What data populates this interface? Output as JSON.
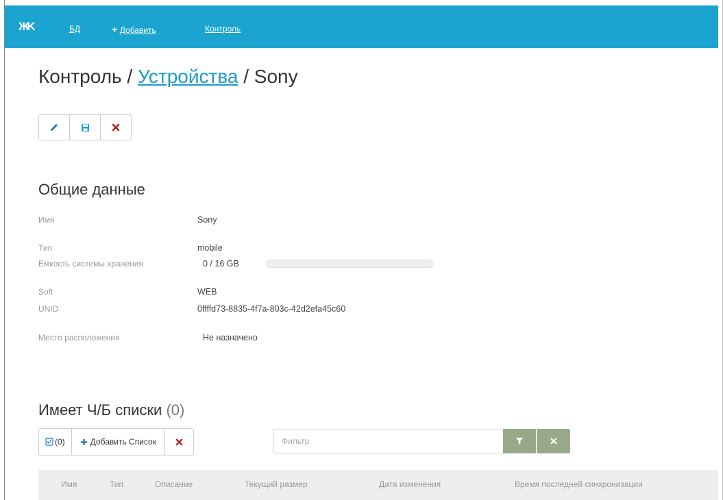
{
  "navbar": {
    "logo_text": "ЖK",
    "links": [
      {
        "label": "БД"
      },
      {
        "label": "Добавить",
        "icon": "plus-icon"
      },
      {
        "label": "Контроль"
      }
    ]
  },
  "breadcrumb": {
    "root": "Контроль",
    "sep1": "/",
    "link": "Устройства",
    "sep2": "/",
    "current": "Sony"
  },
  "toolbar": {
    "buttons": [
      {
        "icon": "pencil-icon",
        "color": "#1a7fc1"
      },
      {
        "icon": "save-icon",
        "color": "#1aa4cf"
      },
      {
        "icon": "close-icon",
        "color": "#b22222"
      }
    ]
  },
  "general": {
    "title": "Общие данные",
    "fields": [
      {
        "label": "Имя",
        "value": "Sony"
      },
      {
        "label": "Тип",
        "value": "mobile"
      },
      {
        "label": "Емкость системы хранения",
        "value": "0 / 16 GB",
        "progress_fraction": 0
      },
      {
        "label": "Soft",
        "value": "WEB"
      },
      {
        "label": "UNID",
        "value": "0ffffd73-8835-4f7a-803c-42d2efa45c60"
      },
      {
        "label": "Место расположения",
        "value": "Не назначено"
      }
    ]
  },
  "lists": {
    "title": "Имеет Ч/Б списки",
    "count": "(0)",
    "select_count": "(0)",
    "add_label": "Добавить Список",
    "filter_placeholder": "Фильтр",
    "columns": [
      "Имя",
      "Тип",
      "Описание",
      "Текущий размер",
      "Дата изменения",
      "Время последней синхронизации"
    ]
  },
  "colors": {
    "navbar": "#1aa4cf",
    "link": "#1a9ccc",
    "danger": "#b22222",
    "filter_button": "#98a98a"
  }
}
